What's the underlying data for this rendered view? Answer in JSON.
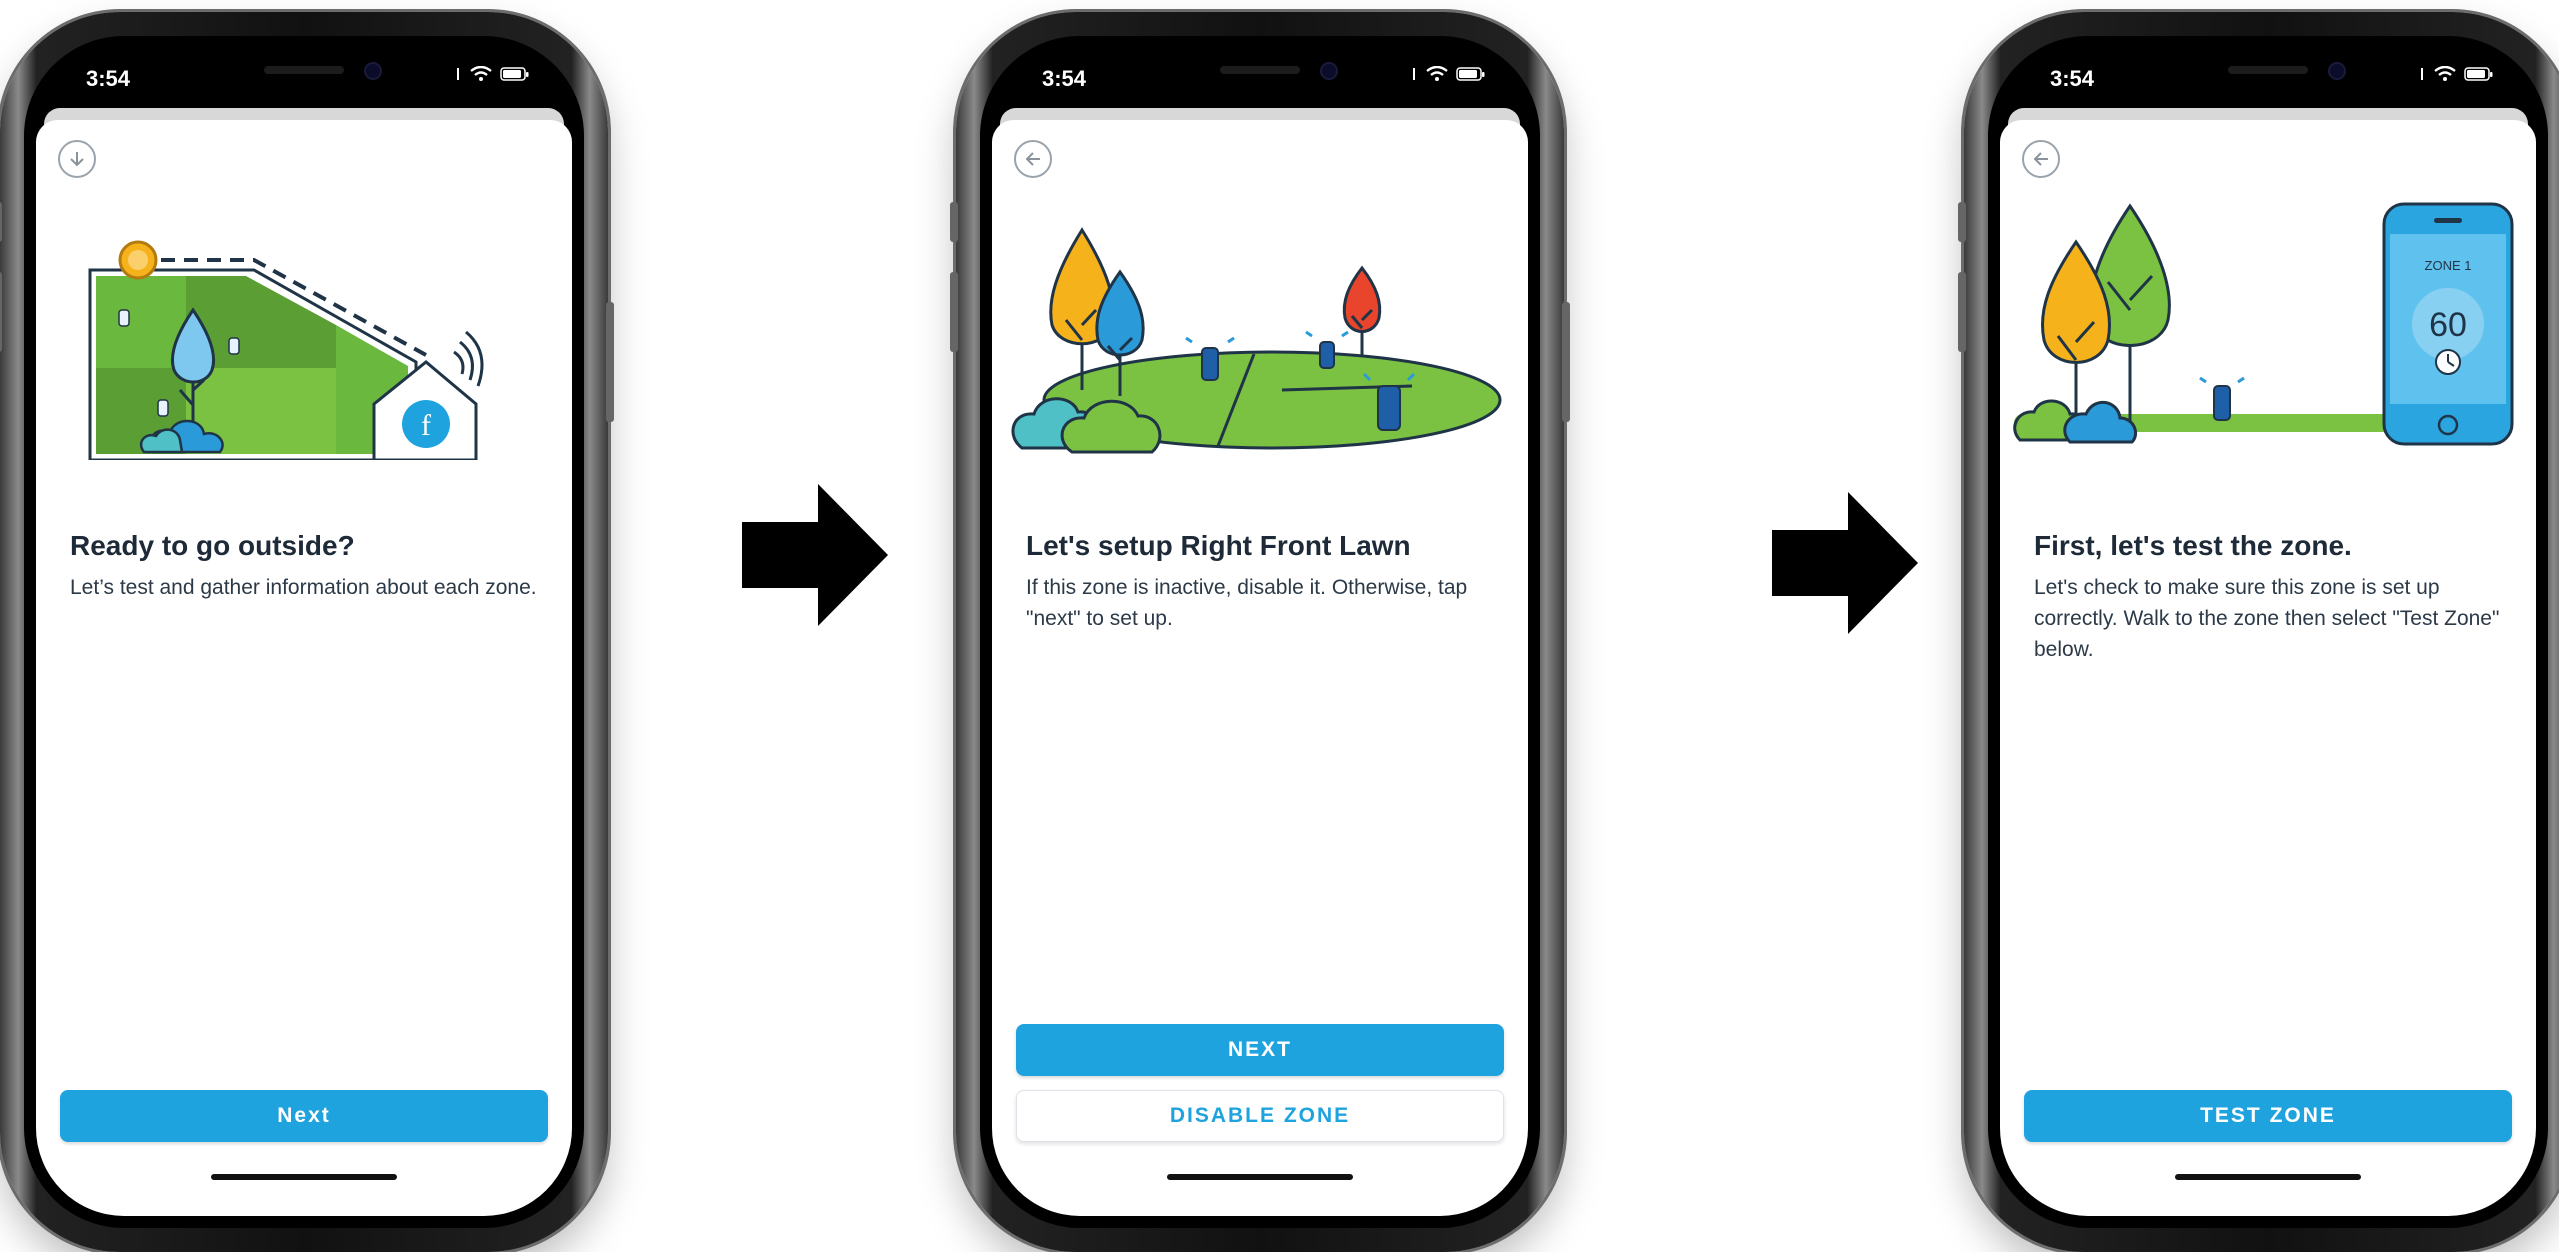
{
  "screens": [
    {
      "status": {
        "time": "3:54"
      },
      "nav_icon": "down-arrow-icon",
      "heading": "Ready to go outside?",
      "description": "Let’s test and gather information about each zone.",
      "primary_button": "Next"
    },
    {
      "status": {
        "time": "3:54"
      },
      "nav_icon": "back-arrow-icon",
      "heading": "Let's setup Right Front Lawn",
      "description": "If this zone is inactive, disable it. Otherwise, tap \"next\" to set up.",
      "primary_button": "NEXT",
      "secondary_button": "DISABLE ZONE"
    },
    {
      "status": {
        "time": "3:54"
      },
      "nav_icon": "back-arrow-icon",
      "heading": "First, let's test the zone.",
      "description": "Let's check to make sure this zone is set up correctly. Walk to the zone then select \"Test Zone\" below.",
      "primary_button": "TEST ZONE",
      "illustration": {
        "zone_label": "ZONE 1",
        "timer_value": "60"
      }
    }
  ],
  "colors": {
    "accent": "#1fa3de",
    "heading": "#1e2a38",
    "text": "#2c3a48",
    "grass_light": "#7cc242",
    "grass_dark": "#5a9e34",
    "tree_orange": "#f6b21b",
    "tree_blue": "#2b9ad8",
    "tree_red": "#e8452c",
    "outline": "#1f3447"
  }
}
